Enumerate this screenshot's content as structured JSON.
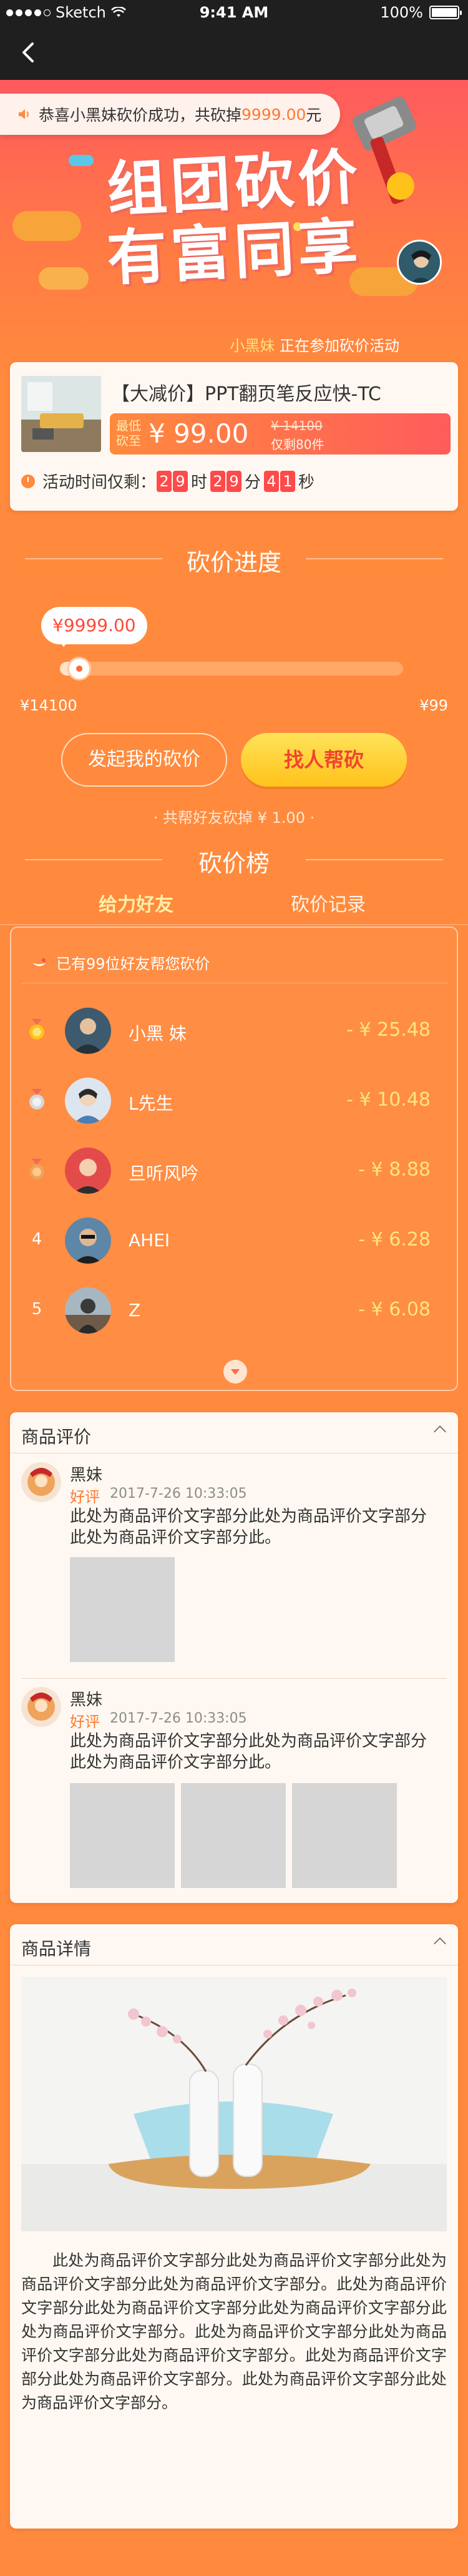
{
  "status_bar": {
    "carrier": "Sketch",
    "time": "9:41 AM",
    "battery": "100%"
  },
  "nav": {
    "back_icon": "chevron-left-icon"
  },
  "hero": {
    "toast_prefix": "恭喜小黑妹砍价成功，共砍掉",
    "toast_amount": "9999.00",
    "toast_suffix": "元",
    "title_line1": "组团砍价",
    "title_line2": "有富同享",
    "participant_name": "小黑妹",
    "participant_text": "正在参加砍价活动"
  },
  "product": {
    "title": "【大减价】PPT翻页笔反应快-TC",
    "price_label": "最低砍至",
    "price": "¥ 99.00",
    "original_price": "¥ 14100",
    "stock": "仅剩80件",
    "timer_label": "活动时间仅剩：",
    "timer": {
      "h": [
        "2",
        "9"
      ],
      "m": [
        "2",
        "9"
      ],
      "s": [
        "4",
        "1"
      ]
    },
    "unit_h": "时",
    "unit_m": "分",
    "unit_s": "秒"
  },
  "progress": {
    "heading": "砍价进度",
    "current": "¥9999.00",
    "progress_fraction": 0.04,
    "max_label": "¥14100",
    "min_label": "¥99",
    "btn_start": "发起我的砍价",
    "btn_help": "找人帮砍",
    "total_text": "· 共帮好友砍掉 ¥ 1.00 ·"
  },
  "leaderboard": {
    "heading": "砍价榜",
    "tab_help": "给力好友",
    "tab_record": "砍价记录",
    "count_text": "已有99位好友帮您砍价",
    "rows": [
      {
        "rank": "1",
        "name": "小黑 妹",
        "amount": "- ¥ 25.48"
      },
      {
        "rank": "2",
        "name": "L先生",
        "amount": "- ¥ 10.48"
      },
      {
        "rank": "3",
        "name": "旦听风吟",
        "amount": "- ¥ 8.88"
      },
      {
        "rank": "4",
        "name": "AHEI",
        "amount": "- ¥ 6.28"
      },
      {
        "rank": "5",
        "name": "Z",
        "amount": "- ¥ 6.08"
      }
    ]
  },
  "reviews": {
    "title": "商品评价",
    "items": [
      {
        "user": "黑妹",
        "rating": "好评",
        "date": "2017-7-26   10:33:05",
        "text": "此处为商品评价文字部分此处为商品评价文字部分此处为商品评价文字部分此。"
      },
      {
        "user": "黑妹",
        "rating": "好评",
        "date": "2017-7-26   10:33:05",
        "text": "此处为商品评价文字部分此处为商品评价文字部分此处为商品评价文字部分此。"
      }
    ]
  },
  "details": {
    "title": "商品详情",
    "text": "此处为商品评价文字部分此处为商品评价文字部分此处为商品评价文字部分此处为商品评价文字部分。此处为商品评价文字部分此处为商品评价文字部分此处为商品评价文字部分此处为商品评价文字部分。此处为商品评价文字部分此处为商品评价文字部分此处为商品评价文字部分。此处为商品评价文字部分此处为商品评价文字部分。此处为商品评价文字部分此处为商品评价文字部分。"
  },
  "colors": {
    "primary": "#FF8A3D",
    "accent": "#FF4A4A",
    "gold": "#FFC21A"
  }
}
